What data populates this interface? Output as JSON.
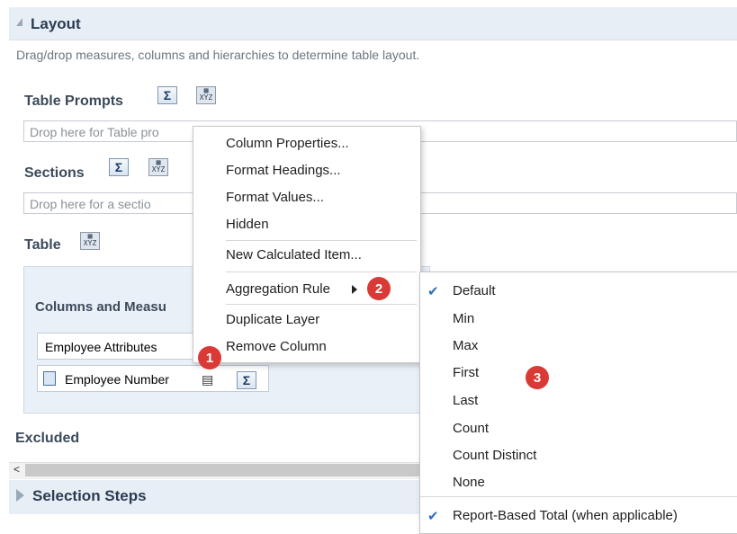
{
  "layout_panel": {
    "title": "Layout",
    "hint": "Drag/drop measures, columns and hierarchies to determine table layout."
  },
  "table_prompts": {
    "label": "Table Prompts",
    "drop_text": "Drop here for Table pro"
  },
  "sections": {
    "label": "Sections",
    "drop_text": "Drop here for a sectio"
  },
  "table": {
    "label": "Table",
    "columns_label": "Columns and Measu",
    "employee_attributes": "Employee Attributes",
    "employee_number": "Employee Number"
  },
  "excluded_label": "Excluded",
  "selection_steps_label": "Selection Steps",
  "icons": {
    "sigma": "Σ"
  },
  "context_menu": {
    "items": [
      "Column Properties...",
      "Format Headings...",
      "Format Values...",
      "Hidden",
      "New Calculated Item...",
      "Aggregation Rule",
      "Duplicate Layer",
      "Remove Column"
    ]
  },
  "aggregation_submenu": {
    "items": [
      "Default",
      "Min",
      "Max",
      "First",
      "Last",
      "Count",
      "Count Distinct",
      "None",
      "Report-Based Total (when applicable)"
    ],
    "checked": [
      "Default",
      "Report-Based Total (when applicable)"
    ]
  },
  "badges": [
    "1",
    "2",
    "3"
  ],
  "colors": {
    "header_bg": "#e8eef5",
    "badge": "#d93a36",
    "check": "#2d6fbd"
  }
}
